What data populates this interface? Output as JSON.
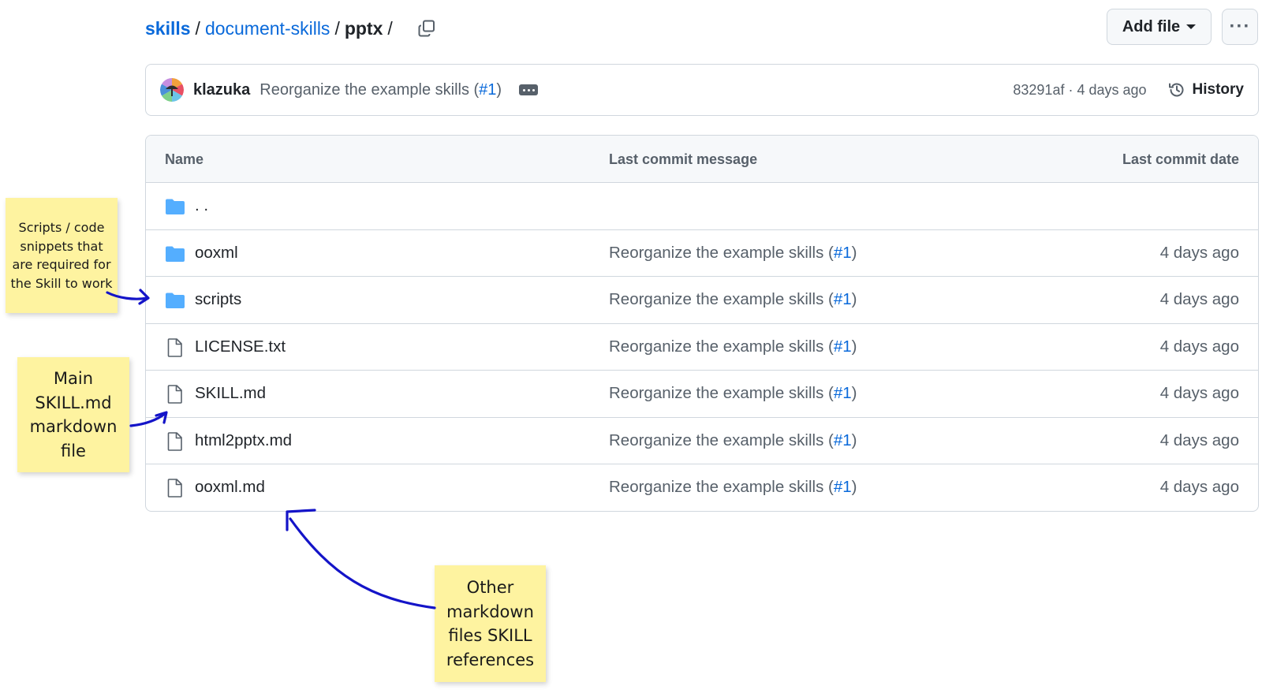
{
  "breadcrumb": {
    "repo": "skills",
    "folder": "document-skills",
    "current": "pptx",
    "separator": "/"
  },
  "toolbar": {
    "add_file_label": "Add file",
    "more_label": "···"
  },
  "commit": {
    "author": "klazuka",
    "message_prefix": "Reorganize the example skills (",
    "pr": "#1",
    "message_suffix": ")",
    "meta": "83291af · 4 days ago",
    "history_label": "History"
  },
  "table": {
    "headers": {
      "name": "Name",
      "message": "Last commit message",
      "date": "Last commit date"
    },
    "parent_label": ". .",
    "rows": [
      {
        "name": "ooxml",
        "type": "folder",
        "msg_prefix": "Reorganize the example skills (",
        "pr": "#1",
        "msg_suffix": ")",
        "date": "4 days ago"
      },
      {
        "name": "scripts",
        "type": "folder",
        "msg_prefix": "Reorganize the example skills (",
        "pr": "#1",
        "msg_suffix": ")",
        "date": "4 days ago"
      },
      {
        "name": "LICENSE.txt",
        "type": "file",
        "msg_prefix": "Reorganize the example skills (",
        "pr": "#1",
        "msg_suffix": ")",
        "date": "4 days ago"
      },
      {
        "name": "SKILL.md",
        "type": "file",
        "msg_prefix": "Reorganize the example skills (",
        "pr": "#1",
        "msg_suffix": ")",
        "date": "4 days ago"
      },
      {
        "name": "html2pptx.md",
        "type": "file",
        "msg_prefix": "Reorganize the example skills (",
        "pr": "#1",
        "msg_suffix": ")",
        "date": "4 days ago"
      },
      {
        "name": "ooxml.md",
        "type": "file",
        "msg_prefix": "Reorganize the example skills (",
        "pr": "#1",
        "msg_suffix": ")",
        "date": "4 days ago"
      }
    ]
  },
  "annotations": {
    "scripts_note": "Scripts / code snippets that are required for the Skill to work",
    "skill_note": "Main SKILL.md markdown file",
    "other_note": "Other markdown files SKILL references"
  },
  "icons": {
    "folder": "folder-icon",
    "file": "file-icon",
    "copy": "copy-icon",
    "history": "history-icon",
    "caret": "caret-down-icon"
  },
  "colors": {
    "link": "#0969da",
    "folder": "#54aeff",
    "note": "#fef3a0",
    "arrow": "#1414c8",
    "border": "#d0d7de"
  }
}
